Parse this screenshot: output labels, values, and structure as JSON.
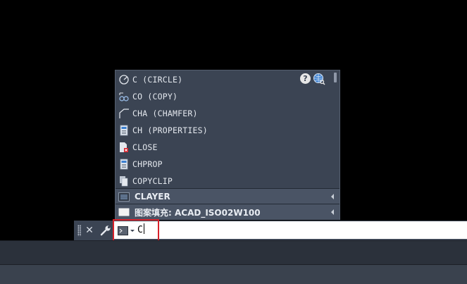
{
  "autocomplete": {
    "items": [
      {
        "label": "C (CIRCLE)",
        "icon": "circle-icon"
      },
      {
        "label": "CO (COPY)",
        "icon": "copy-icon"
      },
      {
        "label": "CHA (CHAMFER)",
        "icon": "chamfer-icon"
      },
      {
        "label": "CH (PROPERTIES)",
        "icon": "properties-icon"
      },
      {
        "label": "CLOSE",
        "icon": "close-document-icon"
      },
      {
        "label": "CHPROP",
        "icon": "chprop-icon"
      },
      {
        "label": "COPYCLIP",
        "icon": "copyclip-icon"
      }
    ],
    "groups": [
      {
        "label": "CLAYER",
        "icon": "layer-icon"
      },
      {
        "label": "图案填充: ACAD_ISO02W100",
        "icon": "hatch-icon"
      }
    ],
    "help_label": "?"
  },
  "command_line": {
    "close_label": "✕",
    "input_value": "C"
  },
  "colors": {
    "popup_bg": "#3b4453",
    "group_bg": "#4a5465",
    "highlight": "#d8212a",
    "canvas": "#000000"
  }
}
